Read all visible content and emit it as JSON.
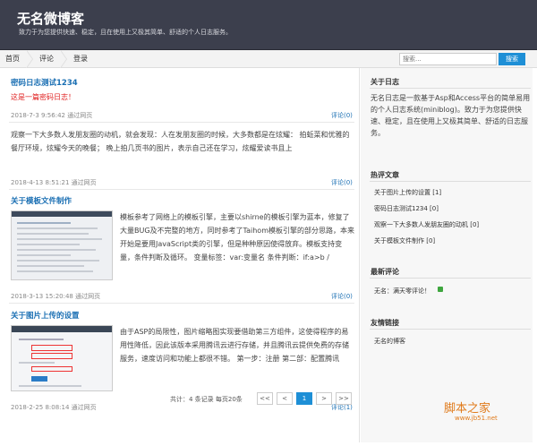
{
  "header": {
    "title": "无名微博客",
    "subtitle": "致力于为您提供快速、稳定，且在使用上又极其简单、舒适的个人日志服务。"
  },
  "nav": {
    "items": [
      "首页",
      "评论",
      "登录"
    ]
  },
  "search": {
    "placeholder": "搜索...",
    "button_label": "搜索"
  },
  "posts": [
    {
      "title": "密码日志测试1234",
      "excerpt": "这是一篇密码日志！",
      "meta": "2018-7-3 9:56:42 通过网页",
      "comments": "评论(0)"
    },
    {
      "title": "",
      "excerpt": "观察一下大多数人发朋友圈的动机，就会发现：人在发朋友圈的时候，大多数都是在炫耀： 拍蚯菜和优雅的餐厅环境，炫耀今天的晚餐； 晚上拍几页书的图片，表示自己还在学习，炫耀爱读书且上",
      "meta": "2018-4-13 8:51:21 通过网页",
      "comments": "评论(0)"
    },
    {
      "title": "关于模板文件制作",
      "excerpt": "模板参考了网络上的模板引擎，主要以shirne的模板引擎为蓝本，修复了大量BUG及不完整的地方，同时参考了Taihom模板引擎的部分思路，本来开始是要用JavaScript类的引擎，但是种种原因使得放弃。模板支持变量，条件判断及循环。 变量标签：var:变量名 条件判断：if:a>b /",
      "meta": "2018-3-13 15:20:48 通过网页",
      "comments": "评论(0)"
    },
    {
      "title": "关于图片上传的设置",
      "excerpt": "由于ASP的局限性，图片缩略图实现要借助第三方组件，这使得程序的易用性降低，因此该版本采用腾讯云进行存储，并且腾讯云提供免费的存储服务，速度访问和功能上都很不错。 第一步：注册 第二部：配置腾讯",
      "meta": "2018-2-25 8:08:14 通过网页",
      "comments": "评论(1)"
    }
  ],
  "pager": {
    "summary": "共计：4 条记录 每页20条",
    "first": "<<",
    "prev": "<",
    "current": "1",
    "next": ">",
    "last": ">>"
  },
  "sidebar": {
    "about_title": "关于日志",
    "about_text": "无名日志是一款基于Asp和Access平台的简单易用的个人日志系统(miniblog)。致力于为您提供快速、稳定，且在使用上又极其简单、舒适的日志服务。",
    "hot_title": "热评文章",
    "hot_items": [
      "关于图片上传的设置 [1]",
      "密码日志测试1234 [0]",
      "观察一下大多数人发朋友圈的动机 [0]",
      "关于模板文件制作 [0]"
    ],
    "recent_title": "最新评论",
    "recent_comment": "无名：满天零评论！",
    "links_title": "友情链接",
    "links_item": "无名的博客"
  },
  "watermark": {
    "text": "脚本之家",
    "url": "www.jb51.net"
  },
  "colors": {
    "header_bg": "#3c3f4d",
    "accent": "#1e8fd6",
    "link": "#1a6fb3",
    "red": "#e02020"
  }
}
